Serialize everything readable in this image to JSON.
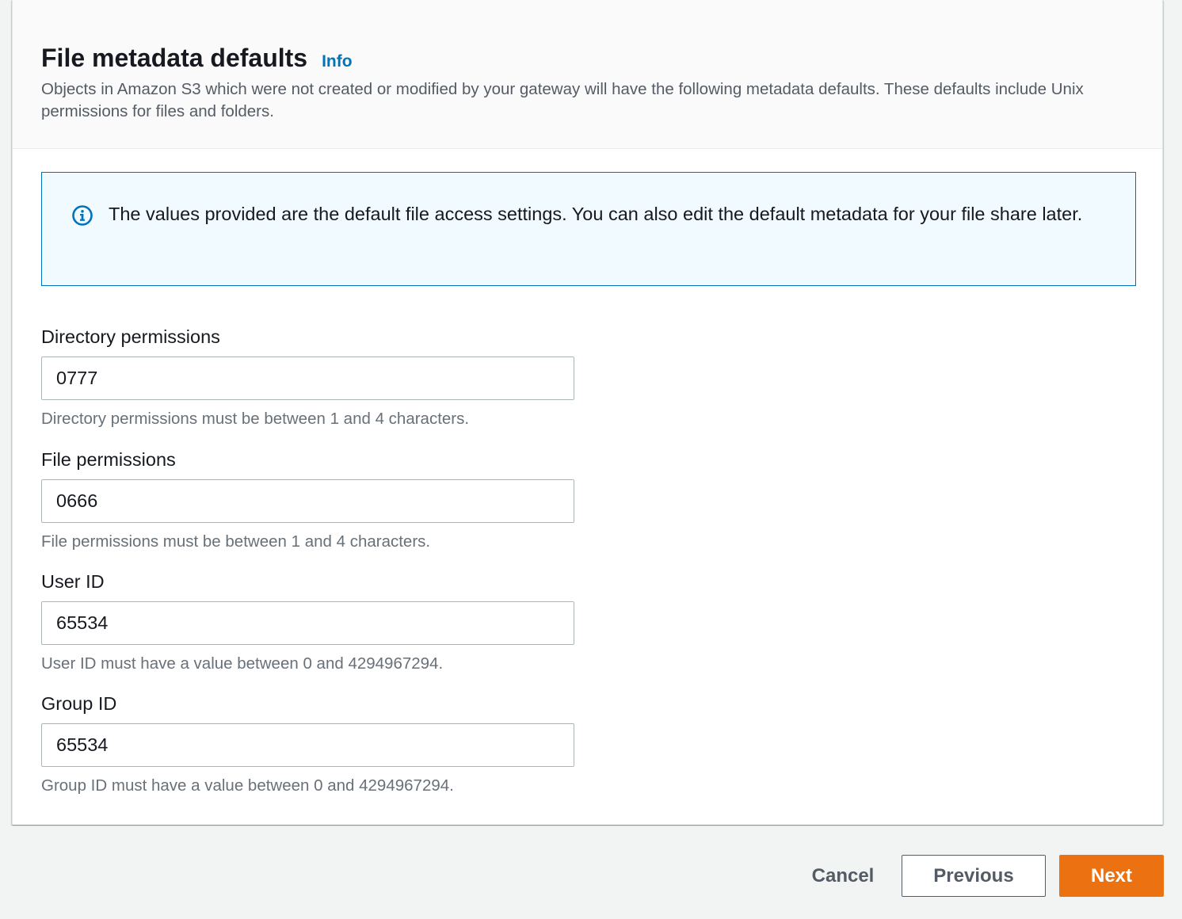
{
  "header": {
    "title": "File metadata defaults",
    "info_link": "Info",
    "description": "Objects in Amazon S3 which were not created or modified by your gateway will have the following metadata defaults. These defaults include Unix permissions for files and folders."
  },
  "alert": {
    "icon": "info-circle-icon",
    "text": "The values provided are the default file access settings. You can also edit the default metadata for your file share later."
  },
  "fields": {
    "directory_permissions": {
      "label": "Directory permissions",
      "value": "0777",
      "hint": "Directory permissions must be between 1 and 4 characters."
    },
    "file_permissions": {
      "label": "File permissions",
      "value": "0666",
      "hint": "File permissions must be between 1 and 4 characters."
    },
    "user_id": {
      "label": "User ID",
      "value": "65534",
      "hint": "User ID must have a value between 0 and 4294967294."
    },
    "group_id": {
      "label": "Group ID",
      "value": "65534",
      "hint": "Group ID must have a value between 0 and 4294967294."
    }
  },
  "footer": {
    "cancel_label": "Cancel",
    "previous_label": "Previous",
    "next_label": "Next"
  },
  "colors": {
    "accent": "#0073bb",
    "primary_button": "#ec7211",
    "page_background": "#f2f3f3",
    "alert_background": "#f1faff"
  }
}
